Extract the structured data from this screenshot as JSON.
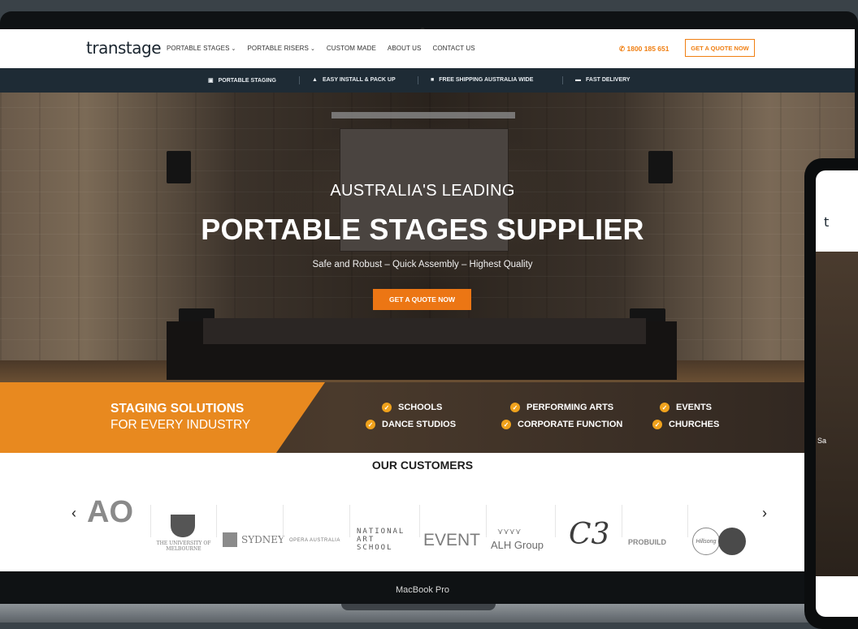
{
  "nav": {
    "logo": "transtage",
    "links": [
      {
        "label": "PORTABLE STAGES",
        "dropdown": true
      },
      {
        "label": "PORTABLE RISERS",
        "dropdown": true
      },
      {
        "label": "CUSTOM MADE",
        "dropdown": false
      },
      {
        "label": "ABOUT US",
        "dropdown": false
      },
      {
        "label": "CONTACT US",
        "dropdown": false
      }
    ],
    "phone": "1800 185 651",
    "quote_button": "GET A QUOTE NOW"
  },
  "features": [
    {
      "icon": "stage-icon",
      "label": "PORTABLE STAGING"
    },
    {
      "icon": "thumbs-up-icon",
      "label": "EASY INSTALL & PACK UP"
    },
    {
      "icon": "truck-icon",
      "label": "FREE SHIPPING AUSTRALIA WIDE"
    },
    {
      "icon": "package-icon",
      "label": "FAST DELIVERY"
    }
  ],
  "hero": {
    "kicker": "AUSTRALIA'S LEADING",
    "title": "PORTABLE STAGES SUPPLIER",
    "tagline": "Safe and Robust – Quick Assembly – Highest Quality",
    "button": "GET A QUOTE NOW"
  },
  "solutions": {
    "heading": "STAGING SOLUTIONS",
    "subheading": "FOR EVERY INDUSTRY",
    "items": [
      "SCHOOLS",
      "DANCE STUDIOS",
      "PERFORMING ARTS",
      "CORPORATE FUNCTION",
      "EVENTS",
      "CHURCHES"
    ]
  },
  "customers": {
    "title": "OUR CUSTOMERS",
    "logos": [
      "AO",
      "THE UNIVERSITY OF MELBOURNE",
      "SYDNEY",
      "OPERA AUSTRALIA",
      "NATIONAL ART SCHOOL",
      "EVENT",
      "ALH Group",
      "C3",
      "PROBUILD",
      "Hillsong"
    ]
  },
  "device_label": "MacBook Pro",
  "phone_preview": {
    "logo": "t",
    "text": "Sa"
  },
  "colors": {
    "accent": "#ec7614",
    "navy": "#1e2b35",
    "band_orange": "#e8891f"
  }
}
